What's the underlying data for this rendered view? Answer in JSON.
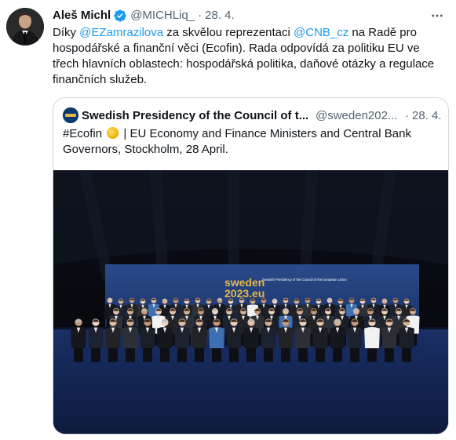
{
  "tweet": {
    "author_name": "Aleš Michl",
    "handle": "@MICHLiq_",
    "separator": "·",
    "date": "28. 4.",
    "text_1": "Díky ",
    "mention_1": "@EZamrazilova",
    "text_2": " za skvělou reprezentaci ",
    "mention_2": "@CNB_cz",
    "text_3": " na Radě pro hospodářské a finanční věci (Ecofin). Rada odpovídá za politiku EU ve třech hlavních oblastech: hospodářská politika, daňové otázky a regulace finančních služeb."
  },
  "quote": {
    "author_name": "Swedish Presidency of the Council of t...",
    "handle": "@sweden202...",
    "separator": "·",
    "date": "28. 4.",
    "hashtag": "#Ecofin",
    "coin_icon": "coin-icon",
    "text": " | EU Economy and Finance Ministers and Central Bank Governors, Stockholm, 28 April.",
    "backdrop_logo_line1": "sweden",
    "backdrop_logo_line2": "2023.eu",
    "backdrop_caption": "Swedish Presidency of the Council of the European Union"
  },
  "colors": {
    "accent": "#1d9bf0",
    "text": "#0f1419",
    "muted": "#536471",
    "border": "#cfd9de",
    "backdrop": "#203a78",
    "logo_gold": "#e7b64b"
  }
}
